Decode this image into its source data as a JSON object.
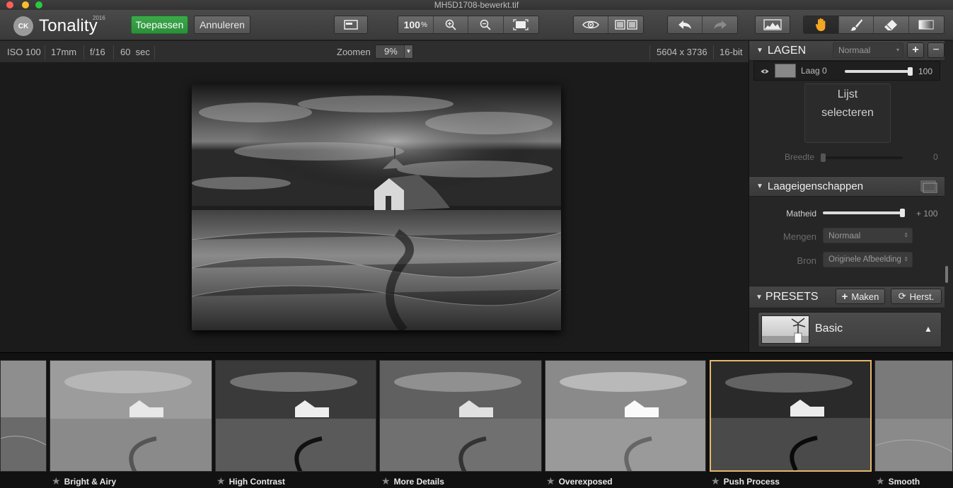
{
  "window": {
    "title": "MH5D1708-bewerkt.tif"
  },
  "app": {
    "logo_badge": "CK",
    "name": "Tonality",
    "year": "2016"
  },
  "toolbar": {
    "apply_label": "Toepassen",
    "cancel_label": "Annuleren",
    "zoom_percent": "100",
    "zoom_percent_unit": "%",
    "icons": [
      "split-view-icon",
      "zoom-in-icon",
      "zoom-out-icon",
      "fit-to-screen-icon",
      "preview-eye-icon",
      "compare-icon",
      "undo-icon",
      "redo-icon",
      "histogram-icon",
      "hand-tool-icon",
      "brush-tool-icon",
      "eraser-tool-icon",
      "gradient-tool-icon"
    ]
  },
  "info": {
    "iso": "ISO 100",
    "focal": "17mm",
    "aperture": "f/16",
    "shutter": "60  sec",
    "zoom_label": "Zoomen",
    "zoom_value": "9%",
    "dimensions": "5604 x 3736",
    "bitdepth": "16-bit"
  },
  "layers": {
    "title": "LAGEN",
    "blend_mode": "Normaal",
    "add_label": "+",
    "remove_label": "−",
    "layer_name": "Laag 0",
    "layer_opacity": "100",
    "layer_opacity_level": 100,
    "list_select_line1": "Lijst",
    "list_select_line2": "selecteren",
    "width_label": "Breedte",
    "width_value": "0",
    "width_level": 0
  },
  "properties": {
    "title": "Laageigenschappen",
    "opacity_label": "Matheid",
    "opacity_value": "+ 100",
    "opacity_level": 100,
    "blend_label": "Mengen",
    "blend_value": "Normaal",
    "source_label": "Bron",
    "source_value": "Originele Afbeelding"
  },
  "presets": {
    "title": "PRESETS",
    "make_label": "Maken",
    "reset_label": "Herst.",
    "current": "Basic"
  },
  "filmstrip": {
    "items": [
      {
        "label": ""
      },
      {
        "label": "Bright & Airy"
      },
      {
        "label": "High Contrast"
      },
      {
        "label": "More Details"
      },
      {
        "label": "Overexposed"
      },
      {
        "label": "Push Process",
        "selected": true
      },
      {
        "label": "Smooth"
      }
    ]
  },
  "colors": {
    "accent_green": "#35a043",
    "selected_border": "#e6b76b"
  }
}
